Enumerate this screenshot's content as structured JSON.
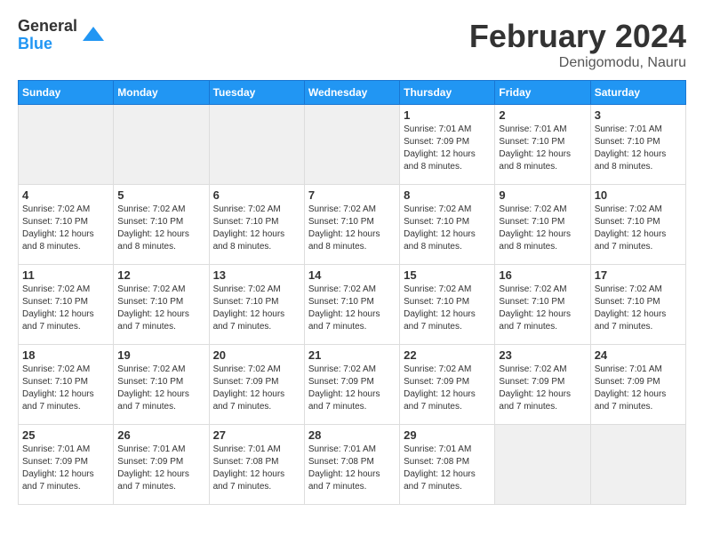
{
  "logo": {
    "general": "General",
    "blue": "Blue"
  },
  "title": {
    "month_year": "February 2024",
    "location": "Denigomodu, Nauru"
  },
  "weekdays": [
    "Sunday",
    "Monday",
    "Tuesday",
    "Wednesday",
    "Thursday",
    "Friday",
    "Saturday"
  ],
  "weeks": [
    [
      {
        "day": "",
        "info": ""
      },
      {
        "day": "",
        "info": ""
      },
      {
        "day": "",
        "info": ""
      },
      {
        "day": "",
        "info": ""
      },
      {
        "day": "1",
        "info": "Sunrise: 7:01 AM\nSunset: 7:09 PM\nDaylight: 12 hours\nand 8 minutes."
      },
      {
        "day": "2",
        "info": "Sunrise: 7:01 AM\nSunset: 7:10 PM\nDaylight: 12 hours\nand 8 minutes."
      },
      {
        "day": "3",
        "info": "Sunrise: 7:01 AM\nSunset: 7:10 PM\nDaylight: 12 hours\nand 8 minutes."
      }
    ],
    [
      {
        "day": "4",
        "info": "Sunrise: 7:02 AM\nSunset: 7:10 PM\nDaylight: 12 hours\nand 8 minutes."
      },
      {
        "day": "5",
        "info": "Sunrise: 7:02 AM\nSunset: 7:10 PM\nDaylight: 12 hours\nand 8 minutes."
      },
      {
        "day": "6",
        "info": "Sunrise: 7:02 AM\nSunset: 7:10 PM\nDaylight: 12 hours\nand 8 minutes."
      },
      {
        "day": "7",
        "info": "Sunrise: 7:02 AM\nSunset: 7:10 PM\nDaylight: 12 hours\nand 8 minutes."
      },
      {
        "day": "8",
        "info": "Sunrise: 7:02 AM\nSunset: 7:10 PM\nDaylight: 12 hours\nand 8 minutes."
      },
      {
        "day": "9",
        "info": "Sunrise: 7:02 AM\nSunset: 7:10 PM\nDaylight: 12 hours\nand 8 minutes."
      },
      {
        "day": "10",
        "info": "Sunrise: 7:02 AM\nSunset: 7:10 PM\nDaylight: 12 hours\nand 7 minutes."
      }
    ],
    [
      {
        "day": "11",
        "info": "Sunrise: 7:02 AM\nSunset: 7:10 PM\nDaylight: 12 hours\nand 7 minutes."
      },
      {
        "day": "12",
        "info": "Sunrise: 7:02 AM\nSunset: 7:10 PM\nDaylight: 12 hours\nand 7 minutes."
      },
      {
        "day": "13",
        "info": "Sunrise: 7:02 AM\nSunset: 7:10 PM\nDaylight: 12 hours\nand 7 minutes."
      },
      {
        "day": "14",
        "info": "Sunrise: 7:02 AM\nSunset: 7:10 PM\nDaylight: 12 hours\nand 7 minutes."
      },
      {
        "day": "15",
        "info": "Sunrise: 7:02 AM\nSunset: 7:10 PM\nDaylight: 12 hours\nand 7 minutes."
      },
      {
        "day": "16",
        "info": "Sunrise: 7:02 AM\nSunset: 7:10 PM\nDaylight: 12 hours\nand 7 minutes."
      },
      {
        "day": "17",
        "info": "Sunrise: 7:02 AM\nSunset: 7:10 PM\nDaylight: 12 hours\nand 7 minutes."
      }
    ],
    [
      {
        "day": "18",
        "info": "Sunrise: 7:02 AM\nSunset: 7:10 PM\nDaylight: 12 hours\nand 7 minutes."
      },
      {
        "day": "19",
        "info": "Sunrise: 7:02 AM\nSunset: 7:10 PM\nDaylight: 12 hours\nand 7 minutes."
      },
      {
        "day": "20",
        "info": "Sunrise: 7:02 AM\nSunset: 7:09 PM\nDaylight: 12 hours\nand 7 minutes."
      },
      {
        "day": "21",
        "info": "Sunrise: 7:02 AM\nSunset: 7:09 PM\nDaylight: 12 hours\nand 7 minutes."
      },
      {
        "day": "22",
        "info": "Sunrise: 7:02 AM\nSunset: 7:09 PM\nDaylight: 12 hours\nand 7 minutes."
      },
      {
        "day": "23",
        "info": "Sunrise: 7:02 AM\nSunset: 7:09 PM\nDaylight: 12 hours\nand 7 minutes."
      },
      {
        "day": "24",
        "info": "Sunrise: 7:01 AM\nSunset: 7:09 PM\nDaylight: 12 hours\nand 7 minutes."
      }
    ],
    [
      {
        "day": "25",
        "info": "Sunrise: 7:01 AM\nSunset: 7:09 PM\nDaylight: 12 hours\nand 7 minutes."
      },
      {
        "day": "26",
        "info": "Sunrise: 7:01 AM\nSunset: 7:09 PM\nDaylight: 12 hours\nand 7 minutes."
      },
      {
        "day": "27",
        "info": "Sunrise: 7:01 AM\nSunset: 7:08 PM\nDaylight: 12 hours\nand 7 minutes."
      },
      {
        "day": "28",
        "info": "Sunrise: 7:01 AM\nSunset: 7:08 PM\nDaylight: 12 hours\nand 7 minutes."
      },
      {
        "day": "29",
        "info": "Sunrise: 7:01 AM\nSunset: 7:08 PM\nDaylight: 12 hours\nand 7 minutes."
      },
      {
        "day": "",
        "info": ""
      },
      {
        "day": "",
        "info": ""
      }
    ]
  ]
}
